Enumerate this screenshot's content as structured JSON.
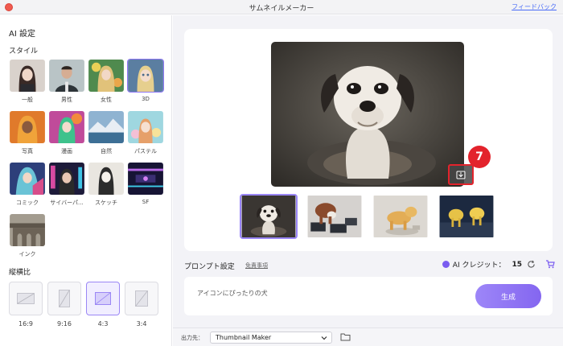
{
  "window": {
    "title": "サムネイルメーカー",
    "feedback": "フィードバック"
  },
  "sidebar": {
    "title": "AI 設定",
    "style_section": "スタイル",
    "styles": [
      {
        "label": "一般",
        "selected": false
      },
      {
        "label": "男性",
        "selected": false
      },
      {
        "label": "女性",
        "selected": false
      },
      {
        "label": "3D",
        "selected": true
      },
      {
        "label": "写真",
        "selected": false
      },
      {
        "label": "漫画",
        "selected": false
      },
      {
        "label": "自然",
        "selected": false
      },
      {
        "label": "パステル",
        "selected": false
      },
      {
        "label": "コミック",
        "selected": false
      },
      {
        "label": "サイバーパ...",
        "selected": false
      },
      {
        "label": "スケッチ",
        "selected": false
      },
      {
        "label": "SF",
        "selected": false
      },
      {
        "label": "インク",
        "selected": false
      }
    ],
    "ratio_section": "縦横比",
    "ratios": [
      {
        "label": "16:9",
        "selected": false
      },
      {
        "label": "9:16",
        "selected": false
      },
      {
        "label": "4:3",
        "selected": true
      },
      {
        "label": "3:4",
        "selected": false
      }
    ]
  },
  "preview": {
    "badge": "7",
    "thumbnails": [
      "dog-portrait",
      "dog-on-blocks",
      "dog-standing",
      "dog-pair"
    ],
    "selected_thumbnail": 0
  },
  "prompt": {
    "title": "プロンプト設定",
    "notice": "免責事項",
    "credit_label": "AI クレジット：",
    "credit_value": "15",
    "value": "アイコンにぴったりの犬",
    "generate": "生成"
  },
  "footer": {
    "output_label": "出力先：",
    "output_value": "Thumbnail Maker"
  },
  "colors": {
    "accent": "#8f77f5",
    "badge": "#e3232c",
    "close": "#f05a4f",
    "link": "#4a6cf7"
  }
}
